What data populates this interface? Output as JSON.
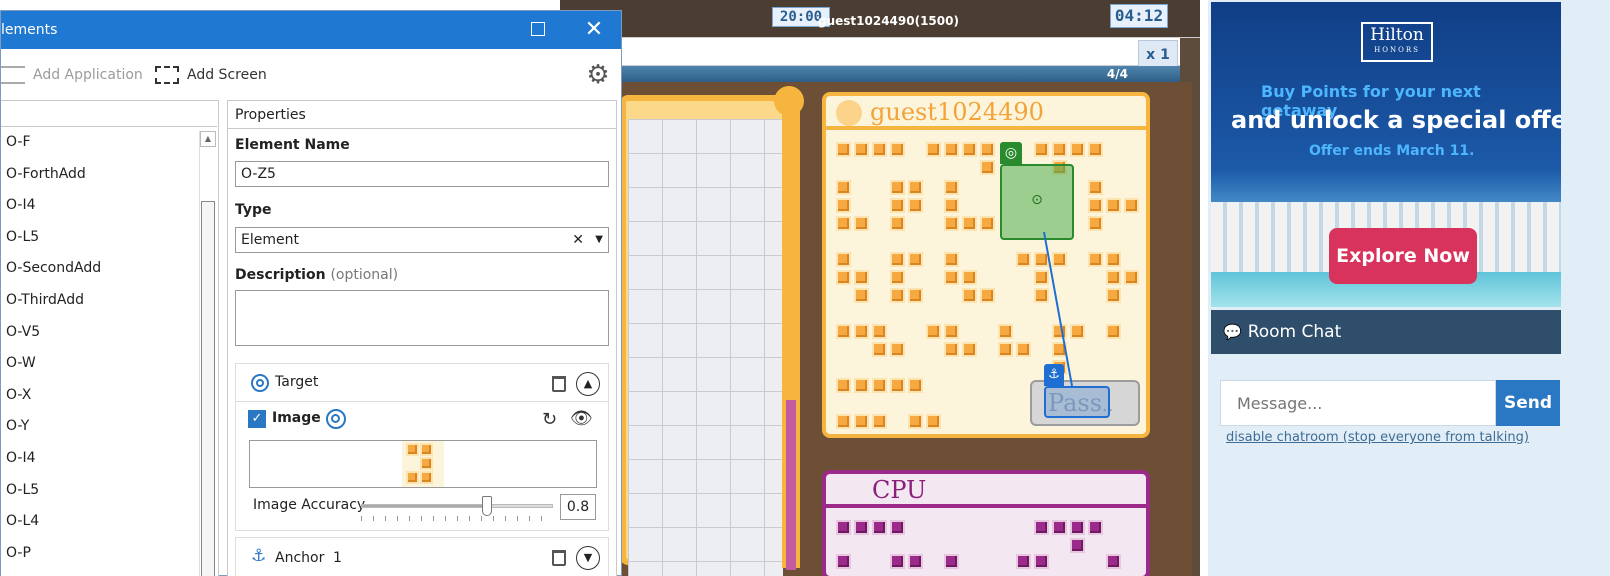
{
  "dialog": {
    "title": "lements",
    "toolbar": {
      "add_application": "Add Application",
      "add_screen": "Add Screen"
    },
    "element_list": [
      "O-F",
      "O-ForthAdd",
      "O-I4",
      "O-L5",
      "O-SecondAdd",
      "O-ThirdAdd",
      "O-V5",
      "O-W",
      "O-X",
      "O-Y",
      "O-I4",
      "O-L5",
      "O-L4",
      "O-P"
    ],
    "properties": {
      "header": "Properties",
      "element_name_label": "Element Name",
      "element_name_value": "O-Z5",
      "type_label": "Type",
      "type_value": "Element",
      "description_label": "Description",
      "description_optional": "(optional)",
      "description_value": "",
      "target": {
        "label": "Target",
        "image_label": "Image",
        "image_checked": true,
        "accuracy_label": "Image Accuracy",
        "accuracy_value": "0.8",
        "accuracy_level": 0.66
      },
      "anchor": {
        "label": "Anchor",
        "count": "1"
      }
    }
  },
  "game": {
    "timer_left": "20:00",
    "player_title": "guest1024490(1500)",
    "timer_right": "04:12",
    "multiplier": "x 1",
    "progress_label": "4/4",
    "player_name": "guest1024490",
    "cpu_name": "CPU",
    "pass_label": "Pass",
    "pass_suffix": ".."
  },
  "ad": {
    "logo_main": "Hilton",
    "logo_sub": "HONORS",
    "line1": "Buy Points for your next getaway",
    "line2": "and unlock a special offer",
    "line3": "Offer ends March 11.",
    "button": "Explore Now"
  },
  "chat": {
    "title": "Room Chat",
    "placeholder": "Message...",
    "send": "Send",
    "disable_link": "disable chatroom (stop everyone from talking)"
  },
  "colors": {
    "accent": "#1f78d1",
    "game_orange": "#f6a940",
    "game_purple": "#9c2a8b",
    "chat_header": "#2f4e6b",
    "ad_button": "#d8335d"
  }
}
